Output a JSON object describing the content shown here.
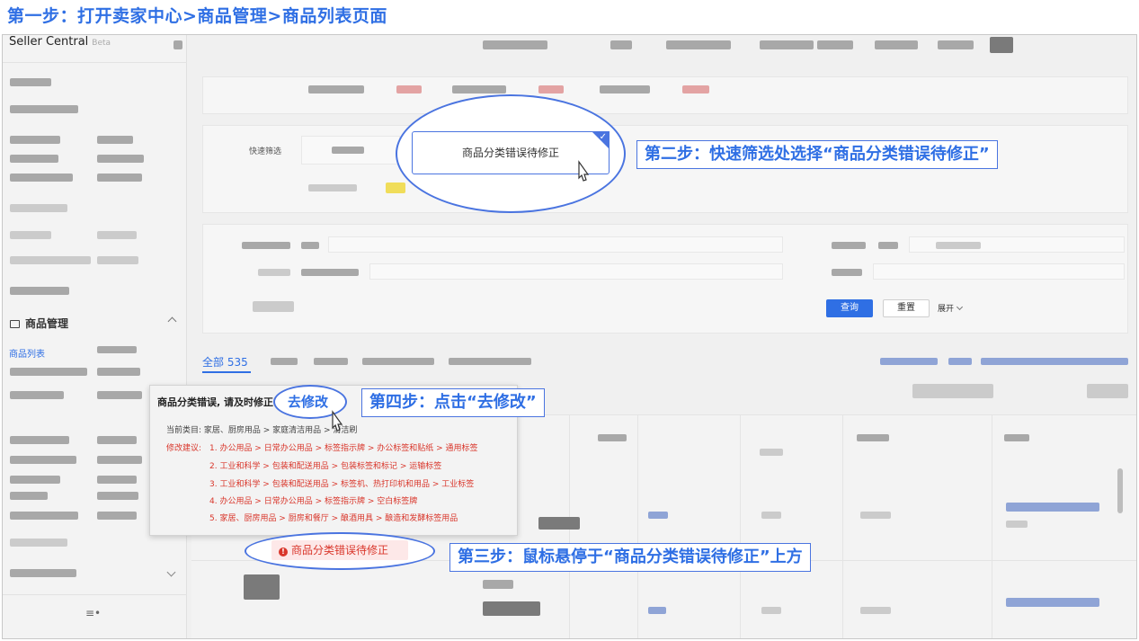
{
  "step1": "第一步：打开卖家中心>商品管理>商品列表页面",
  "step2": "第二步：快速筛选处选择“商品分类错误待修正”",
  "step3": "第三步：鼠标悬停于“商品分类错误待修正”上方",
  "step4": "第四步：点击“去修改”",
  "app": {
    "brand": "Seller Central",
    "beta": "Beta"
  },
  "sidebar": {
    "section": "商品管理",
    "active_item": "商品列表",
    "collapse_icon": "≡•"
  },
  "filters": {
    "quick_label": "快速筛选",
    "selected_chip": "商品分类错误待修正",
    "check": "✓"
  },
  "actions": {
    "query": "查询",
    "reset": "重置",
    "expand": "展开"
  },
  "tabs": {
    "all": "全部 535"
  },
  "popover": {
    "title": "商品分类错误, 请及时修正",
    "fix_link": "去修改",
    "current_label": "当前类目: 家居、厨房用品 > 家庭清洁用品 > 清洁刷",
    "suggest_label": "修改建议:",
    "suggestions": [
      "1. 办公用品 > 日常办公用品 > 标签指示牌 > 办公标签和贴纸 > 通用标签",
      "2. 工业和科学 > 包装和配送用品 > 包装标签和标记 > 运输标签",
      "3. 工业和科学 > 包装和配送用品 > 标签机、热打印机和用品 > 工业标签",
      "4. 办公用品 > 日常办公用品 > 标签指示牌 > 空白标签牌",
      "5. 家居、厨房用品 > 厨房和餐厅 > 酿酒用具 > 酿造和发酵标签用品"
    ]
  },
  "badge": {
    "text": "商品分类错误待修正",
    "icon": "!"
  },
  "colors": {
    "accent": "#2f6fe4",
    "error": "#d9362b"
  }
}
